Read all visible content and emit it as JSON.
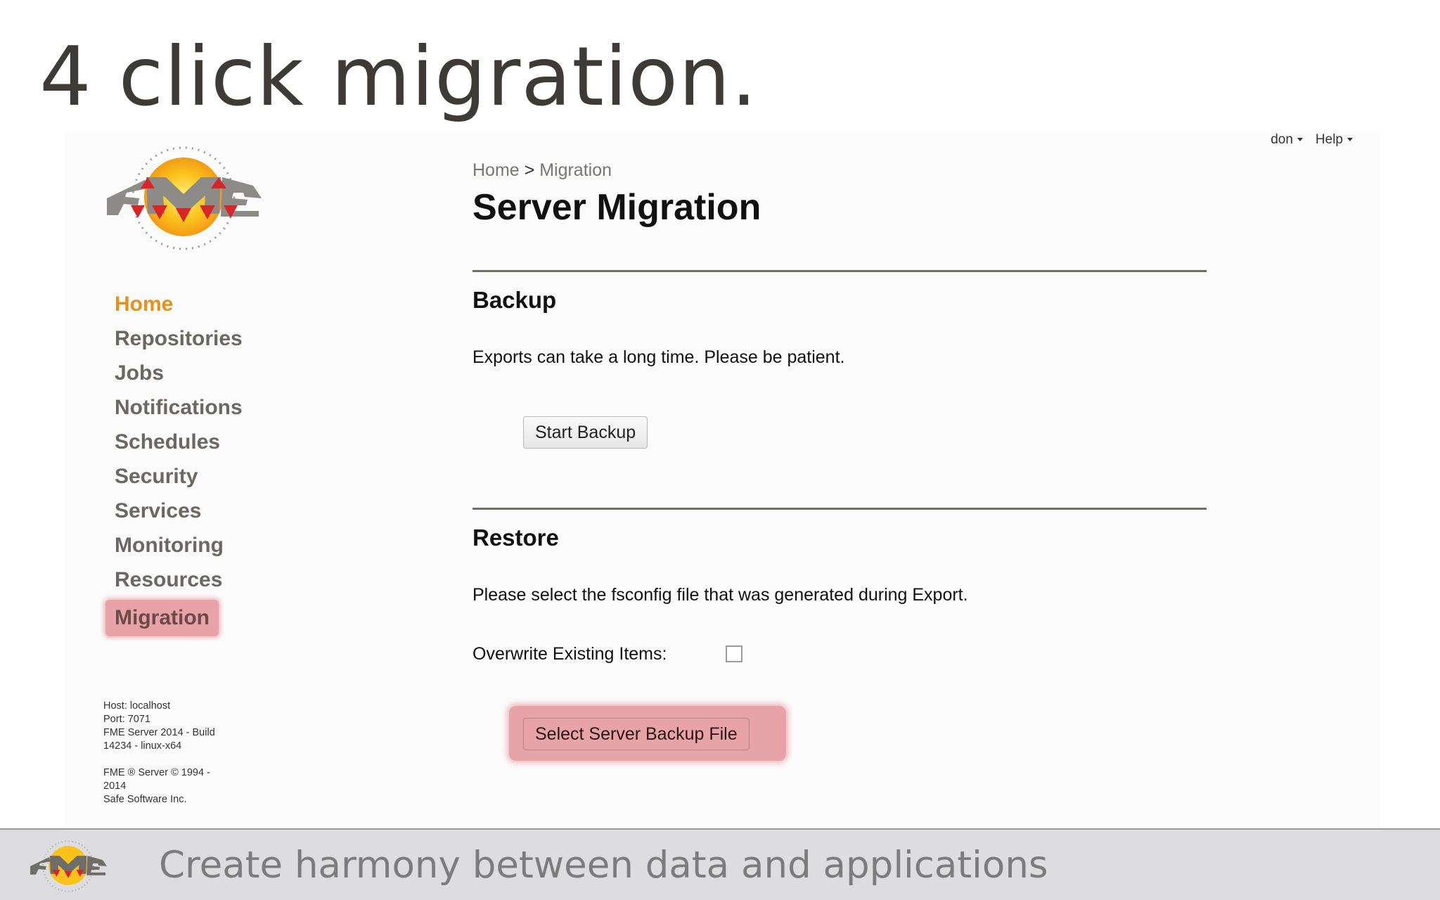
{
  "slide": {
    "title": "4 click migration.",
    "tagline": "Create harmony between data and applications"
  },
  "user_menu": {
    "user": "don",
    "help": "Help"
  },
  "logo": {
    "text": "FME"
  },
  "nav": {
    "items": [
      {
        "label": "Home"
      },
      {
        "label": "Repositories"
      },
      {
        "label": "Jobs"
      },
      {
        "label": "Notifications"
      },
      {
        "label": "Schedules"
      },
      {
        "label": "Security"
      },
      {
        "label": "Services"
      },
      {
        "label": "Monitoring"
      },
      {
        "label": "Resources"
      },
      {
        "label": "Migration"
      }
    ],
    "active_color": "#e8901a",
    "highlight_color": "#e7a3a8"
  },
  "server_info": {
    "host": "Host: localhost",
    "port": "Port: 7071",
    "build_line1": "FME Server 2014 - Build",
    "build_line2": "14234 - linux-x64",
    "copyright_line1": "FME ® Server © 1994 -",
    "copyright_line2": "2014",
    "company": "Safe Software Inc."
  },
  "breadcrumb": {
    "home": "Home",
    "separator": ">",
    "current": "Migration"
  },
  "page_title": "Server Migration",
  "backup": {
    "title": "Backup",
    "description": "Exports can take a long time. Please be patient.",
    "button_label": "Start Backup"
  },
  "restore": {
    "title": "Restore",
    "description": "Please select the fsconfig file that was generated during Export.",
    "overwrite_label": "Overwrite Existing Items:",
    "overwrite_checked": false,
    "button_label": "Select Server Backup File"
  }
}
